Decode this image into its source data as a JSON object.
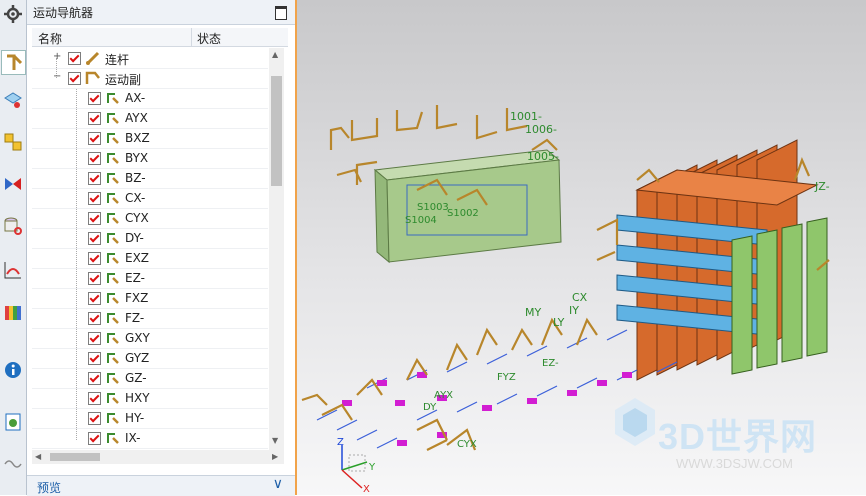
{
  "navigator": {
    "title": "运动导航器",
    "columns": {
      "name": "名称",
      "status": "状态"
    },
    "footer": "预览",
    "items": [
      {
        "label": "连杆",
        "expander": "+"
      },
      {
        "label": "运动副",
        "expander": "−"
      },
      {
        "label": "AX-"
      },
      {
        "label": "AYX"
      },
      {
        "label": "BXZ"
      },
      {
        "label": "BYX"
      },
      {
        "label": "BZ-"
      },
      {
        "label": "CX-"
      },
      {
        "label": "CYX"
      },
      {
        "label": "DY-"
      },
      {
        "label": "EXZ"
      },
      {
        "label": "EZ-"
      },
      {
        "label": "FXZ"
      },
      {
        "label": "FZ-"
      },
      {
        "label": "GXY"
      },
      {
        "label": "GYZ"
      },
      {
        "label": "GZ-"
      },
      {
        "label": "HXY"
      },
      {
        "label": "HY-"
      },
      {
        "label": "IX-"
      }
    ]
  },
  "viewport": {
    "annotations": {
      "a1": "1001-",
      "a2": "1006-",
      "a3": "1005-",
      "a4": "S1003",
      "a5": "S1004",
      "a6": "S1002",
      "jz": "JZ-",
      "my": "MY",
      "ly": "LY",
      "cx": "CX",
      "iy": "IY",
      "ez": "EZ-",
      "fyz": "FYZ",
      "dy": "DY",
      "ayx": "AYX",
      "cyx": "CYX"
    },
    "triad": {
      "z": "Z",
      "y": "Y",
      "x": "X"
    },
    "watermark": {
      "title": "3D世界网",
      "url": "WWW.3DSJW.COM"
    }
  },
  "colors": {
    "accent": "#f1a34a",
    "link": "#1d5fa8",
    "motion_arrow": "#b8862b",
    "plate_green": "#a7c98b",
    "bar_orange": "#d66a2c",
    "bar_blue": "#5fb2e3",
    "bar_green": "#8fc66b",
    "label_magenta": "#d21ed2"
  },
  "icons": [
    "gear-icon",
    "link-icon",
    "joint-icon",
    "motion-check-icon",
    "maximize-icon",
    "chevron-down-icon"
  ]
}
